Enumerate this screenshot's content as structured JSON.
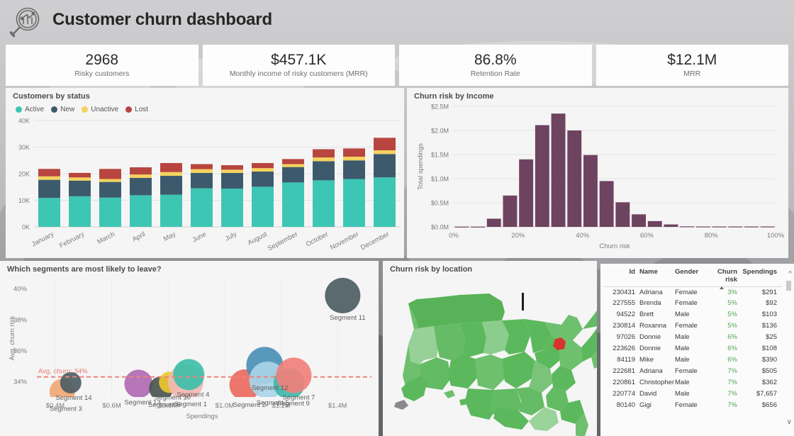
{
  "header": {
    "title": "Customer churn dashboard",
    "logo_icon": "magnifier-chart-icon"
  },
  "kpis": [
    {
      "value": "2968",
      "label": "Risky customers"
    },
    {
      "value": "$457.1K",
      "label": "Monthly income of risky customers (MRR)"
    },
    {
      "value": "86.8%",
      "label": "Retention Rate"
    },
    {
      "value": "$12.1M",
      "label": "MRR"
    }
  ],
  "panels": {
    "customers_by_status": "Customers by status",
    "churn_risk_by_income": "Churn risk by Income",
    "segments": "Which segments are most likely to leave?",
    "map": "Churn risk by location"
  },
  "colors": {
    "active": "#3dc6b4",
    "new": "#3d5a6c",
    "unactive": "#f4d35e",
    "lost": "#b8453f",
    "histogram": "#6e4360",
    "avg_line": "#ef8279",
    "map_green": "#5cb85c",
    "map_highlight": "#d9342b",
    "risk_text": "#53a552"
  },
  "chart_data": [
    {
      "type": "bar",
      "id": "customers-by-status",
      "title": "Customers by status",
      "stacked": true,
      "xlabel": "",
      "ylabel": "",
      "ylim": [
        0,
        40000
      ],
      "yticks": [
        "0K",
        "10K",
        "20K",
        "30K",
        "40K"
      ],
      "ytick_values": [
        0,
        10000,
        20000,
        30000,
        40000
      ],
      "grid": true,
      "legend_position": "top-left",
      "categories": [
        "January",
        "February",
        "March",
        "April",
        "May",
        "June",
        "July",
        "August",
        "September",
        "October",
        "November",
        "December"
      ],
      "series": [
        {
          "name": "Active",
          "color": "#3dc6b4",
          "values": [
            10900,
            11500,
            11000,
            11900,
            12100,
            14500,
            14400,
            15100,
            16700,
            17500,
            18000,
            18600
          ]
        },
        {
          "name": "New",
          "color": "#3d5a6c",
          "values": [
            6800,
            5900,
            5900,
            6500,
            7100,
            5800,
            5900,
            5700,
            5800,
            7200,
            7000,
            8800
          ]
        },
        {
          "name": "Unactive",
          "color": "#f4d35e",
          "values": [
            1300,
            1200,
            1100,
            1300,
            1400,
            1400,
            1200,
            1300,
            1100,
            1400,
            1400,
            1400
          ]
        },
        {
          "name": "Lost",
          "color": "#b8453f",
          "values": [
            2800,
            1700,
            3800,
            2700,
            3400,
            1900,
            1700,
            1900,
            1900,
            3100,
            3100,
            4700
          ]
        }
      ]
    },
    {
      "type": "bar",
      "id": "churn-risk-by-income",
      "title": "Churn risk by Income",
      "xlabel": "Churn risk",
      "ylabel": "Total spendings",
      "xticks": [
        "0%",
        "20%",
        "40%",
        "60%",
        "80%",
        "100%"
      ],
      "xtick_values": [
        0,
        20,
        40,
        60,
        80,
        100
      ],
      "yticks": [
        "$0.0M",
        "$0.5M",
        "$1.0M",
        "$1.5M",
        "$2.0M",
        "$2.5M"
      ],
      "ytick_values": [
        0,
        0.5,
        1.0,
        1.5,
        2.0,
        2.5
      ],
      "ylim": [
        0,
        2.5
      ],
      "xlim": [
        0,
        100
      ],
      "grid": true,
      "bin_width": 5,
      "categories": [
        "0",
        "5",
        "10",
        "15",
        "20",
        "25",
        "30",
        "35",
        "40",
        "45",
        "50",
        "55",
        "60",
        "65",
        "70",
        "75",
        "80",
        "85",
        "90",
        "95"
      ],
      "values": [
        0.005,
        0.005,
        0.17,
        0.65,
        1.4,
        2.11,
        2.35,
        2.0,
        1.49,
        0.95,
        0.51,
        0.26,
        0.12,
        0.05,
        0.01,
        0.008,
        0.008,
        0.008,
        0.008,
        0.008
      ]
    },
    {
      "type": "scatter",
      "id": "segments-bubble",
      "title": "Which segments are most likely to leave?",
      "xlabel": "Spendings",
      "ylabel": "Avg. churn risk",
      "xticks": [
        "$0.4M",
        "$0.6M",
        "$0.8M",
        "$1.0M",
        "$1.2M",
        "$1.4M"
      ],
      "xtick_values": [
        0.4,
        0.6,
        0.8,
        1.0,
        1.2,
        1.4
      ],
      "yticks": [
        "34%",
        "36%",
        "38%",
        "40%"
      ],
      "ytick_values": [
        34,
        36,
        38,
        40
      ],
      "xlim": [
        0.32,
        1.52
      ],
      "ylim": [
        33.0,
        40.6
      ],
      "grid": true,
      "annotation": {
        "text": "Avg. churn: 34%",
        "value": 34.3,
        "style": "dashed",
        "color": "#ef8279"
      },
      "points": [
        {
          "label": "Segment 3",
          "x": 0.425,
          "y": 33.35,
          "r": 18,
          "color": "#f0a875"
        },
        {
          "label": "Segment 14",
          "x": 0.455,
          "y": 33.92,
          "r": 15,
          "color": "#4d5d63"
        },
        {
          "label": "Segment 13",
          "x": 0.695,
          "y": 33.85,
          "r": 20,
          "color": "#b06ab3"
        },
        {
          "label": "Segment 6",
          "x": 0.775,
          "y": 33.55,
          "r": 17,
          "color": "#4b5450"
        },
        {
          "label": "Segment 10",
          "x": 0.805,
          "y": 33.95,
          "r": 15,
          "color": "#edc72b"
        },
        {
          "label": "Segment 1",
          "x": 0.862,
          "y": 33.97,
          "r": 25,
          "color": "#f0b9b4"
        },
        {
          "label": "Segment 4",
          "x": 0.873,
          "y": 34.45,
          "r": 22,
          "color": "#3dbfa8"
        },
        {
          "label": "Segment 2",
          "x": 1.072,
          "y": 33.78,
          "r": 22,
          "color": "#ea6a5e"
        },
        {
          "label": "Segment 12",
          "x": 1.142,
          "y": 35.05,
          "r": 26,
          "color": "#4a90b5"
        },
        {
          "label": "Segment 5",
          "x": 1.152,
          "y": 34.1,
          "r": 26,
          "color": "#a9d4e8"
        },
        {
          "label": "Segment 9",
          "x": 1.228,
          "y": 33.86,
          "r": 22,
          "color": "#3fb9ab"
        },
        {
          "label": "Segment 7",
          "x": 1.245,
          "y": 34.4,
          "r": 25,
          "color": "#f0807a"
        },
        {
          "label": "Segment 11",
          "x": 1.418,
          "y": 39.55,
          "r": 25,
          "color": "#4d5d63"
        }
      ]
    },
    {
      "type": "heatmap",
      "id": "churn-risk-map",
      "title": "Churn risk by location",
      "region": "United States",
      "base_color": "#5cb85c",
      "highlight_color": "#d9342b",
      "highlight_region": "Maryland"
    }
  ],
  "table": {
    "columns": [
      "Id",
      "Name",
      "Gender",
      "Churn risk",
      "Spendings"
    ],
    "sort_column": "Churn risk",
    "sort_direction": "ascending",
    "scroll_up_icon": "chevron-up-icon",
    "scroll_down_icon": "chevron-down-icon",
    "rows": [
      {
        "id": "230431",
        "name": "Adriana",
        "gender": "Female",
        "risk": "3%",
        "spendings": "$291"
      },
      {
        "id": "227555",
        "name": "Brenda",
        "gender": "Female",
        "risk": "5%",
        "spendings": "$92"
      },
      {
        "id": "94522",
        "name": "Brett",
        "gender": "Male",
        "risk": "5%",
        "spendings": "$103"
      },
      {
        "id": "230814",
        "name": "Roxanna",
        "gender": "Female",
        "risk": "5%",
        "spendings": "$136"
      },
      {
        "id": "97026",
        "name": "Donnie",
        "gender": "Male",
        "risk": "6%",
        "spendings": "$25"
      },
      {
        "id": "223626",
        "name": "Donnie",
        "gender": "Male",
        "risk": "6%",
        "spendings": "$108"
      },
      {
        "id": "84119",
        "name": "Mike",
        "gender": "Male",
        "risk": "6%",
        "spendings": "$390"
      },
      {
        "id": "222681",
        "name": "Adriana",
        "gender": "Female",
        "risk": "7%",
        "spendings": "$505"
      },
      {
        "id": "220861",
        "name": "Christopher",
        "gender": "Male",
        "risk": "7%",
        "spendings": "$362"
      },
      {
        "id": "220774",
        "name": "David",
        "gender": "Male",
        "risk": "7%",
        "spendings": "$7,657"
      },
      {
        "id": "80140",
        "name": "Gigi",
        "gender": "Female",
        "risk": "7%",
        "spendings": "$656"
      }
    ]
  }
}
